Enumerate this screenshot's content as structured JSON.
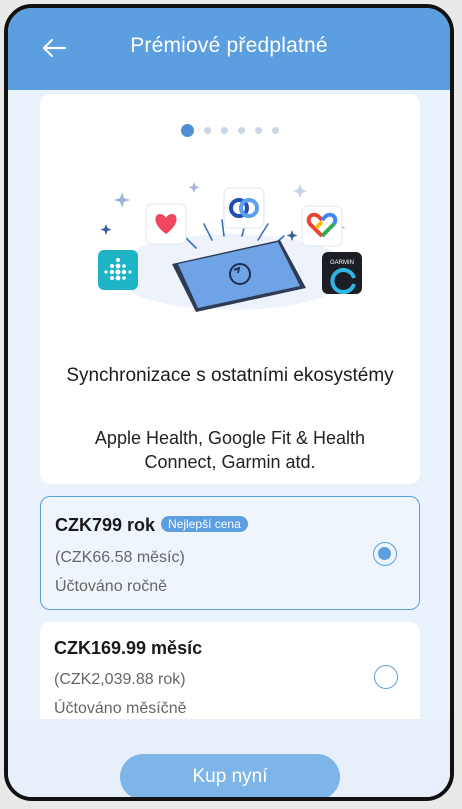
{
  "header": {
    "title": "Prémiové předplatné",
    "back_icon": "arrow-left-icon"
  },
  "carousel": {
    "total": 6,
    "active_index": 0
  },
  "feature": {
    "title": "Synchronizace s ostatními ekosystémy",
    "description": "Apple Health, Google Fit & Health Connect, Garmin atd.",
    "illustration_icons": [
      "fitbit-icon",
      "apple-health-icon",
      "health-connect-icon",
      "google-fit-icon",
      "garmin-connect-icon",
      "sync-tablet-icon"
    ],
    "garmin_label": "GARMIN"
  },
  "plans": [
    {
      "price": "CZK799 rok",
      "badge": "Nejlepší cena",
      "per_period": "(CZK66.58 měsíc)",
      "billing": "Účtováno ročně",
      "selected": true
    },
    {
      "price": "CZK169.99 měsíc",
      "badge": "",
      "per_period": "(CZK2,039.88 rok)",
      "billing": "Účtováno měsíčně",
      "selected": false
    }
  ],
  "cta": {
    "label": "Kup nyní"
  },
  "colors": {
    "accent": "#5b9fe1",
    "button": "#7eb5e8",
    "background": "#eaf2fb"
  }
}
